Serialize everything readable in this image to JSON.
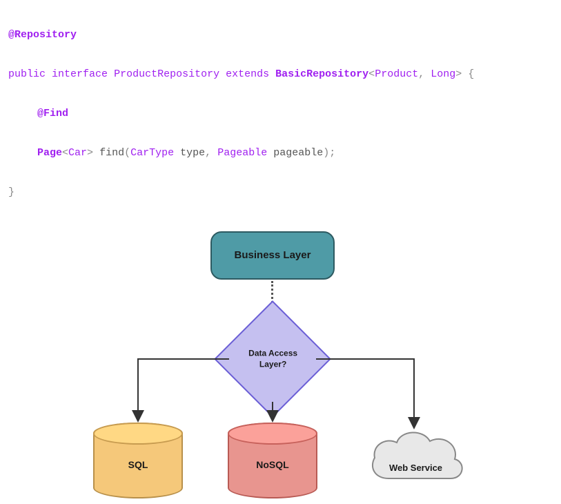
{
  "code": {
    "annotation_repository": "@Repository",
    "kw_public": "public",
    "kw_interface": "interface",
    "class_ProductRepository": "ProductRepository",
    "kw_extends": "extends",
    "class_BasicRepository": "BasicRepository",
    "type_Product": "Product",
    "type_Long": "Long",
    "brace_open": "{",
    "annotation_find": "@Find",
    "class_Page": "Page",
    "type_Car": "Car",
    "method_find": "find",
    "type_CarType": "CarType",
    "param_type": "type",
    "type_Pageable": "Pageable",
    "param_pageable": "pageable",
    "brace_close": "}",
    "lt": "<",
    "gt": ">",
    "comma": ",",
    "paren_open": "(",
    "paren_close": ")",
    "semi": ";"
  },
  "diagram": {
    "business_layer": "Business Layer",
    "data_access_line1": "Data Access",
    "data_access_line2": "Layer?",
    "sql": "SQL",
    "nosql": "NoSQL",
    "web_service": "Web Service",
    "colors": {
      "business": "#4f9ba6",
      "decision": "#c5c0f0",
      "sql": "#f5c87a",
      "nosql": "#e8958f",
      "cloud": "#e8e8e8"
    }
  }
}
